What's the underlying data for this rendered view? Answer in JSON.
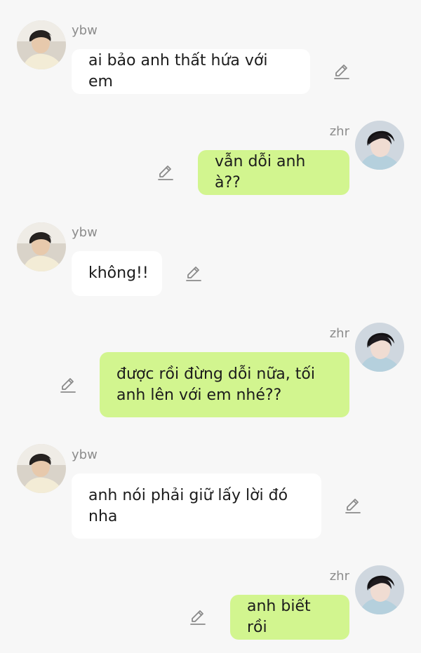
{
  "chat": {
    "colors": {
      "background": "#f7f7f7",
      "left_bubble": "#ffffff",
      "right_bubble": "#d2f58f",
      "name_text": "#8c8c8c",
      "message_text": "#1c1c1c",
      "edit_icon": "#8a8a8a"
    },
    "messages": [
      {
        "side": "left",
        "sender": "ybw",
        "avatar_icon": "avatar-ybw-icon",
        "text": "ai bảo anh thất hứa với em",
        "edit_icon": "pencil-icon"
      },
      {
        "side": "right",
        "sender": "zhr",
        "avatar_icon": "avatar-zhr-icon",
        "text": "vẫn dỗi anh à??",
        "edit_icon": "pencil-icon"
      },
      {
        "side": "left",
        "sender": "ybw",
        "avatar_icon": "avatar-ybw-icon",
        "text": "không!!",
        "edit_icon": "pencil-icon"
      },
      {
        "side": "right",
        "sender": "zhr",
        "avatar_icon": "avatar-zhr-icon",
        "text": "được rồi đừng dỗi nữa, tối anh lên với em nhé??",
        "edit_icon": "pencil-icon"
      },
      {
        "side": "left",
        "sender": "ybw",
        "avatar_icon": "avatar-ybw-icon",
        "text": "anh nói phải giữ lấy lời đó nha",
        "edit_icon": "pencil-icon"
      },
      {
        "side": "right",
        "sender": "zhr",
        "avatar_icon": "avatar-zhr-icon",
        "text": "anh biết rồi",
        "edit_icon": "pencil-icon"
      }
    ]
  }
}
